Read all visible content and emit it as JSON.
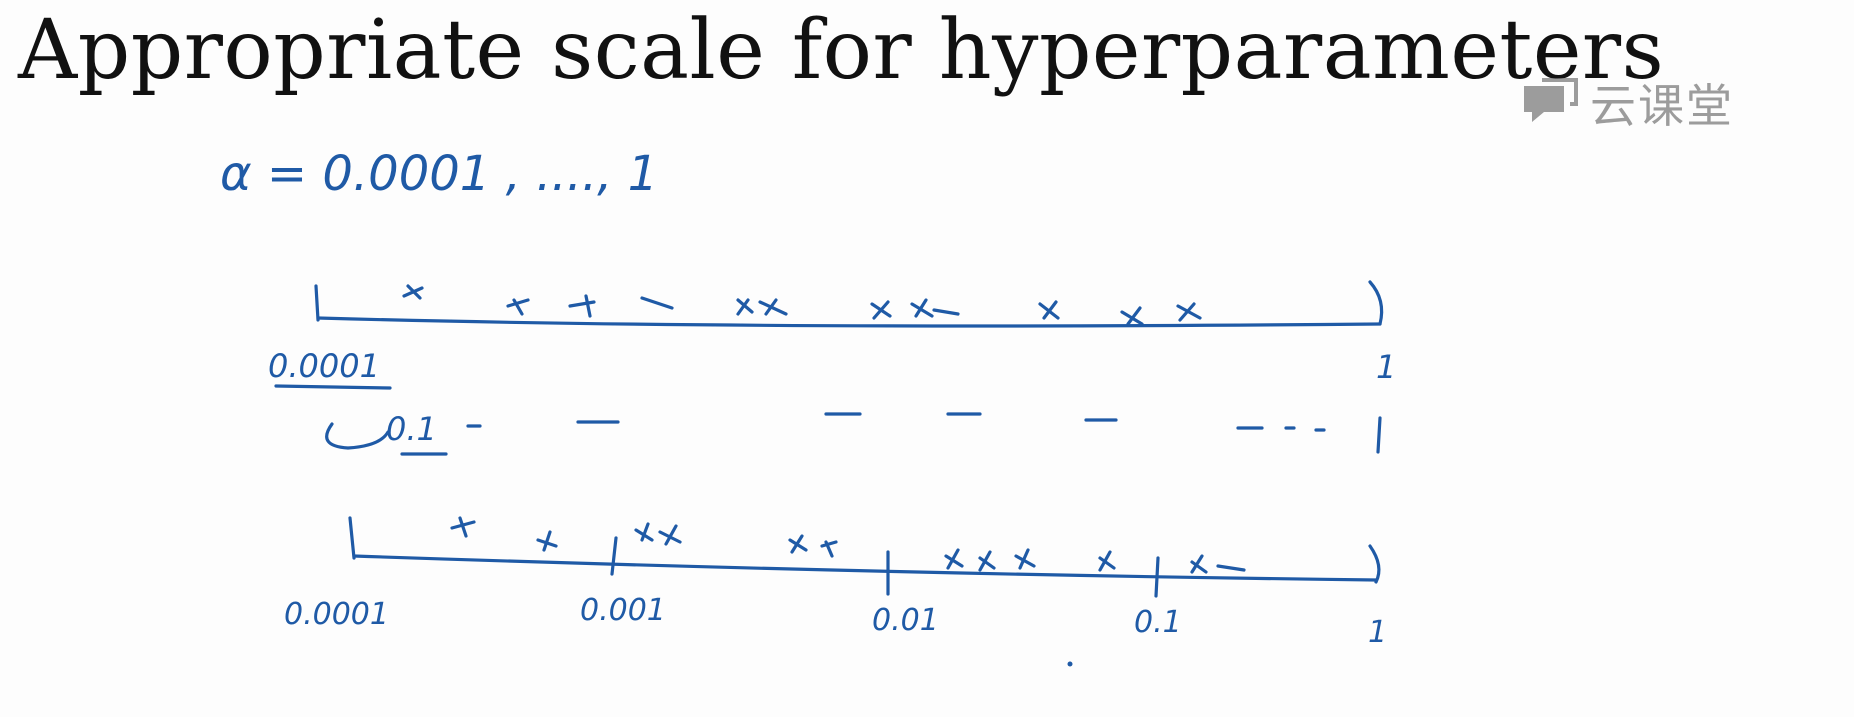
{
  "slide": {
    "title": "Appropriate scale for hyperparameters"
  },
  "watermark": {
    "text": "云课堂",
    "icon": "chat-bubble-icon"
  },
  "handwriting": {
    "alpha_range": "α = 0.0001 , ...., 1",
    "linear_axis": {
      "left_label": "0.0001",
      "right_label": "1",
      "sample_marks": 14
    },
    "subrange_row": {
      "left_label": "0.1",
      "right_label": "1"
    },
    "log_axis": {
      "tick_labels": [
        "0.0001",
        "0.001",
        "0.01",
        "0.1",
        "1"
      ],
      "sample_marks": 14
    }
  },
  "colors": {
    "ink": "#1f5aa6",
    "title": "#111111",
    "watermark": "#777777",
    "background": "#fdfdfd"
  }
}
